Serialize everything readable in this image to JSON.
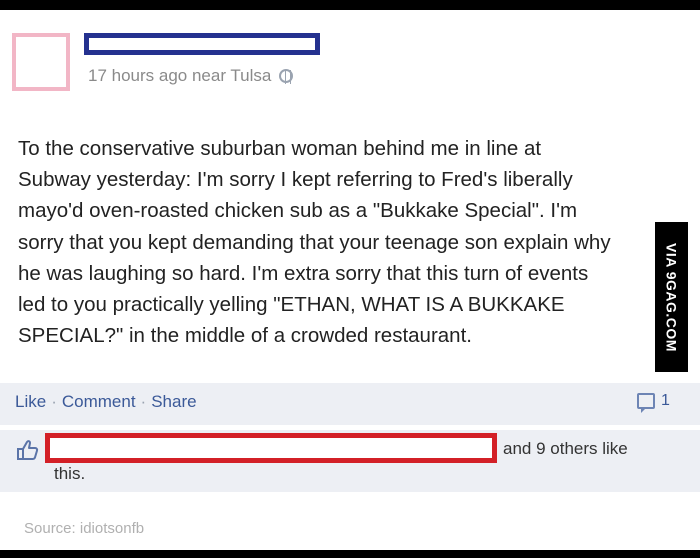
{
  "post": {
    "meta_text": "17 hours ago near Tulsa",
    "body_lines": [
      "To the conservative suburban woman behind me in line at",
      "Subway yesterday: I'm sorry I kept referring to Fred's liberally",
      "mayo'd oven-roasted chicken sub as a \"Bukkake Special\". I'm",
      "sorry that you kept demanding that your teenage son explain why",
      "he was laughing so hard. I'm extra sorry that this turn of events",
      "led to you practically yelling \"ETHAN, WHAT IS A BUKKAKE",
      "SPECIAL?\" in the middle of a crowded restaurant."
    ]
  },
  "actions": {
    "like": "Like",
    "comment": "Comment",
    "share": "Share",
    "separator": "·",
    "comment_count": "1"
  },
  "likes": {
    "tail_line1": "and 9 others like",
    "tail_line2": "this."
  },
  "watermark": "VIA 9GAG.COM",
  "source": "Source: idiotsonfb",
  "colors": {
    "avatar_border": "#f2b6c6",
    "name_redaction": "#24318f",
    "likes_redaction": "#d32027",
    "link_blue": "#3b5998",
    "action_bg": "#edeff4"
  }
}
